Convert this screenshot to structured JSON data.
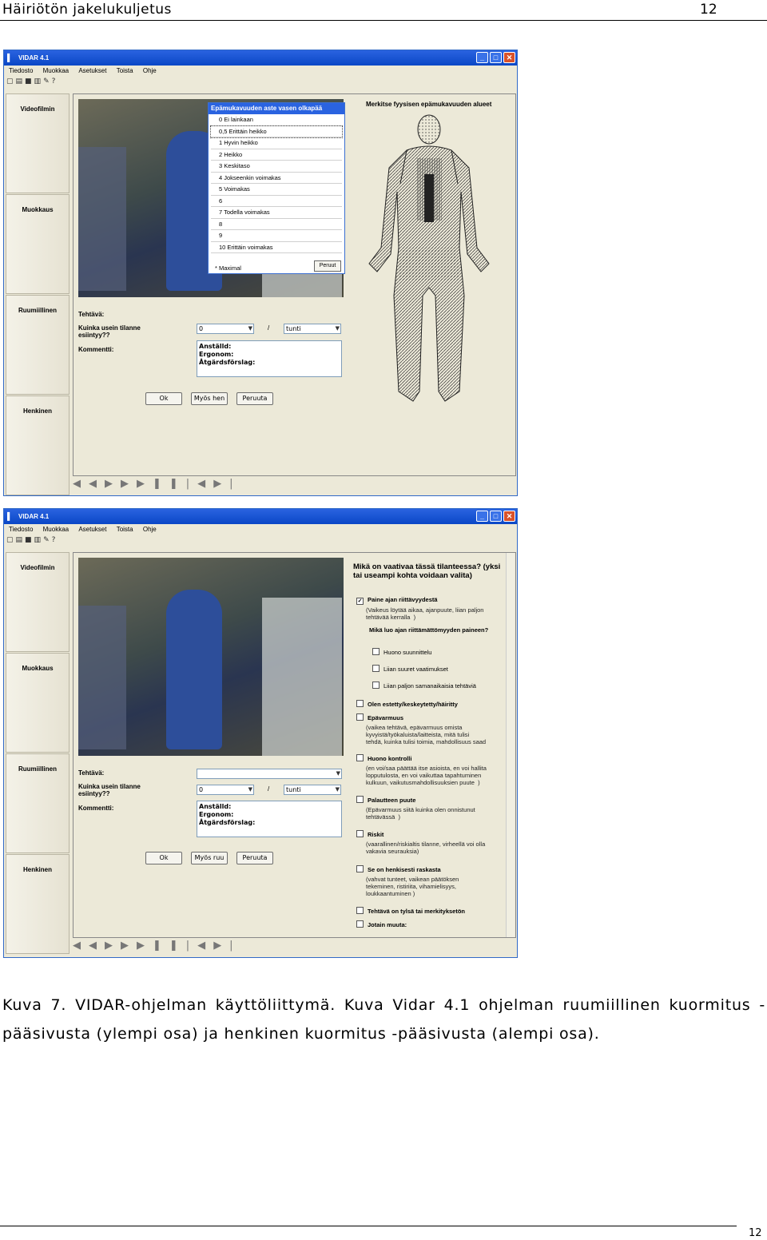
{
  "header": {
    "title": "Häiriötön jakelukuljetus",
    "page_number": "12"
  },
  "app": {
    "title": "VIDAR 4.1",
    "menu": [
      "Tiedosto",
      "Muokkaa",
      "Asetukset",
      "Toista",
      "Ohje"
    ],
    "sidebar": [
      "Videofilmin",
      "Muokkaus",
      "Ruumiillinen",
      "Henkinen"
    ],
    "form": {
      "task_label": "Tehtävä:",
      "freq_label": "Kuinka usein tilanne esiintyy??",
      "comment_label": "Kommentti:",
      "freq_value": "0",
      "separator": "/",
      "unit_value": "tunti",
      "notes": "Anställd:\nErgonom:\nÅtgärdsförslag:",
      "buttons": [
        "Ok",
        "Myös hen",
        "Peruuta"
      ],
      "buttons_lower": [
        "Ok",
        "Myös ruu",
        "Peruuta"
      ]
    }
  },
  "upper": {
    "popup": {
      "title": "Epämukavuuden aste vasen olkapää",
      "options": [
        "0 Ei lainkaan",
        "0,5 Erittäin heikko",
        "1 Hyvin heikko",
        "2 Heikko",
        "3 Keskitaso",
        "4 Jokseenkin voimakas",
        "5 Voimakas",
        "6",
        "7 Todella voimakas",
        "8",
        "9",
        "10 Erittäin voimakas"
      ],
      "footer": "* Maximal",
      "cancel": "Peruut"
    },
    "body_title": "Merkitse fyysisen epämukavuuden alueet"
  },
  "lower": {
    "question": "Mikä on vaativaa tässä tilanteessa? (yksi tai useampi kohta voidaan valita)",
    "items": [
      {
        "label": "Paine ajan riittävyydestä",
        "checked": "✓",
        "desc": "(Vaikeus löytää aikaa, ajanpuute, liian paljon\ntehtävää kerralla  )"
      },
      {
        "label": "Mikä luo ajan riittämättömyyden paineen?",
        "desc": ""
      },
      {
        "label": "Huono suunnittelu",
        "desc": ""
      },
      {
        "label": "Liian suuret vaatimukset",
        "desc": ""
      },
      {
        "label": "Liian paljon samanaikaisia tehtäviä",
        "desc": ""
      },
      {
        "label": "Olen estetty/keskeytetty/häiritty",
        "desc": ""
      },
      {
        "label": "Epävarmuus",
        "desc": "(vaikea tehtävä, epävarmuus omista\nkyvyistä/työkaluista/laitteista, mitä tulisi\ntehdä, kuinka tulisi toimia, mahdollisuus saad"
      },
      {
        "label": "Huono kontrolli",
        "desc": "(en voi/saa päättää itse asioista, en voi hallita\nlopputulosta, en voi vaikuttaa tapahtuminen\nkulkuun, vaikutusmahdollisuuksien puute  )"
      },
      {
        "label": "Palautteen puute",
        "desc": "(Epävarmuus siitä kuinka olen onnistunut\ntehtävässä  )"
      },
      {
        "label": "Riskit",
        "desc": "(vaarallinen/riskialtis tilanne, virheellä voi olla\nvakavia seurauksia)"
      },
      {
        "label": "Se on henkisesti raskasta",
        "desc": "(vahvat tunteet, vaikean päätöksen\ntekeminen, ristiriita, vihamielisyys,\nloukkaantuminen )"
      },
      {
        "label": "Tehtävä on tylsä tai merkityksetön",
        "desc": ""
      },
      {
        "label": "Jotain muuta:",
        "desc": ""
      }
    ]
  },
  "caption": "Kuva 7. VIDAR-ohjelman käyttöliittymä. Kuva Vidar 4.1 ohjelman ruumiillinen kuormitus -pääsivusta (ylempi osa) ja henkinen kuormitus -pääsivusta (alempi osa).",
  "footer": {
    "page_number": "12"
  }
}
